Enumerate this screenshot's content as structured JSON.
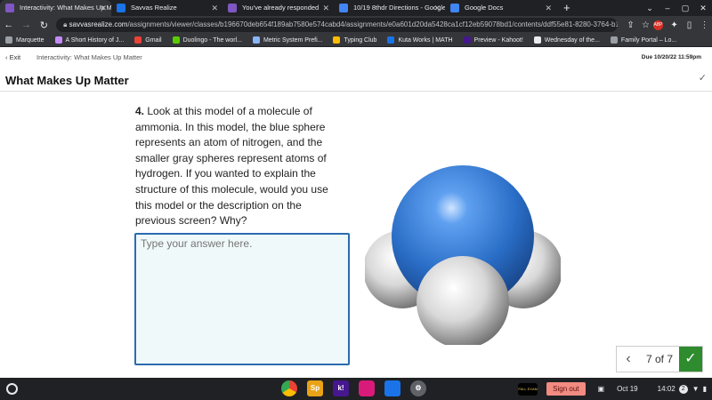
{
  "browser": {
    "tabs": [
      {
        "label": "Interactivity: What Makes Up Ma",
        "color": "#7e57c2"
      },
      {
        "label": "Savvas Realize",
        "color": "#1a73e8"
      },
      {
        "label": "You've already responded",
        "color": "#7e57c2"
      },
      {
        "label": "10/19 8thdr Directions - Google",
        "color": "#4285f4"
      },
      {
        "label": "Google Docs",
        "color": "#4285f4"
      }
    ],
    "new_tab": "+",
    "url_host": "savvasrealize.com",
    "url_path": "/assignments/viewer/classes/b196670deb654f189ab7580e574cabd4/assignments/e0a601d20da5428ca1cf12eb59078bd1/contents/ddf55e81-8280-3764-b150-90...",
    "abp_label": "ABP"
  },
  "bookmarks": [
    {
      "label": "Marquette",
      "color": "#9aa0a6"
    },
    {
      "label": "A Short History of J...",
      "color": "#c58af9"
    },
    {
      "label": "Gmail",
      "color": "#ea4335"
    },
    {
      "label": "Duolingo - The worl...",
      "color": "#58cc02"
    },
    {
      "label": "Metric System Prefi...",
      "color": "#8ab4f8"
    },
    {
      "label": "Typing Club",
      "color": "#fbbc04"
    },
    {
      "label": "Kuta Works | MATH",
      "color": "#1a73e8"
    },
    {
      "label": "Preview - Kahoot!",
      "color": "#46178f"
    },
    {
      "label": "Wednesday of the...",
      "color": "#e8eaed"
    },
    {
      "label": "Family Portal – Lo...",
      "color": "#9aa0a6"
    }
  ],
  "header": {
    "exit": "‹ Exit",
    "breadcrumb": "Interactivity: What Makes Up Matter",
    "due": "Due 10/20/22 11:59pm",
    "title": "What Makes Up Matter"
  },
  "question": {
    "number": "4.",
    "text": " Look at this model of a molecule of ammonia. In this model, the blue sphere represents an atom of nitrogen, and the smaller gray spheres represent atoms of hydrogen. If you wanted to explain the structure of this molecule, would you use this model or the description on the previous screen? Why?",
    "answer_placeholder": "Type your answer here."
  },
  "pager": {
    "count": "7 of 7",
    "prev": "‹",
    "done": "✓"
  },
  "shelf": {
    "sign_out": "Sign out",
    "date": "Oct 19",
    "time": "14:02",
    "notification_count": "2",
    "avatar_text": "FALL EXAM",
    "apps": [
      {
        "name": "chrome-icon",
        "label": "",
        "color": "#ea4335"
      },
      {
        "name": "sp-icon",
        "label": "Sp",
        "color": "#e8a317"
      },
      {
        "name": "kahoot-icon",
        "label": "k!",
        "color": "#46178f"
      },
      {
        "name": "app-pink-icon",
        "label": "",
        "color": "#d81b7a"
      },
      {
        "name": "files-icon",
        "label": "",
        "color": "#1a73e8"
      },
      {
        "name": "settings-icon",
        "label": "",
        "color": "#5f6368"
      }
    ]
  }
}
